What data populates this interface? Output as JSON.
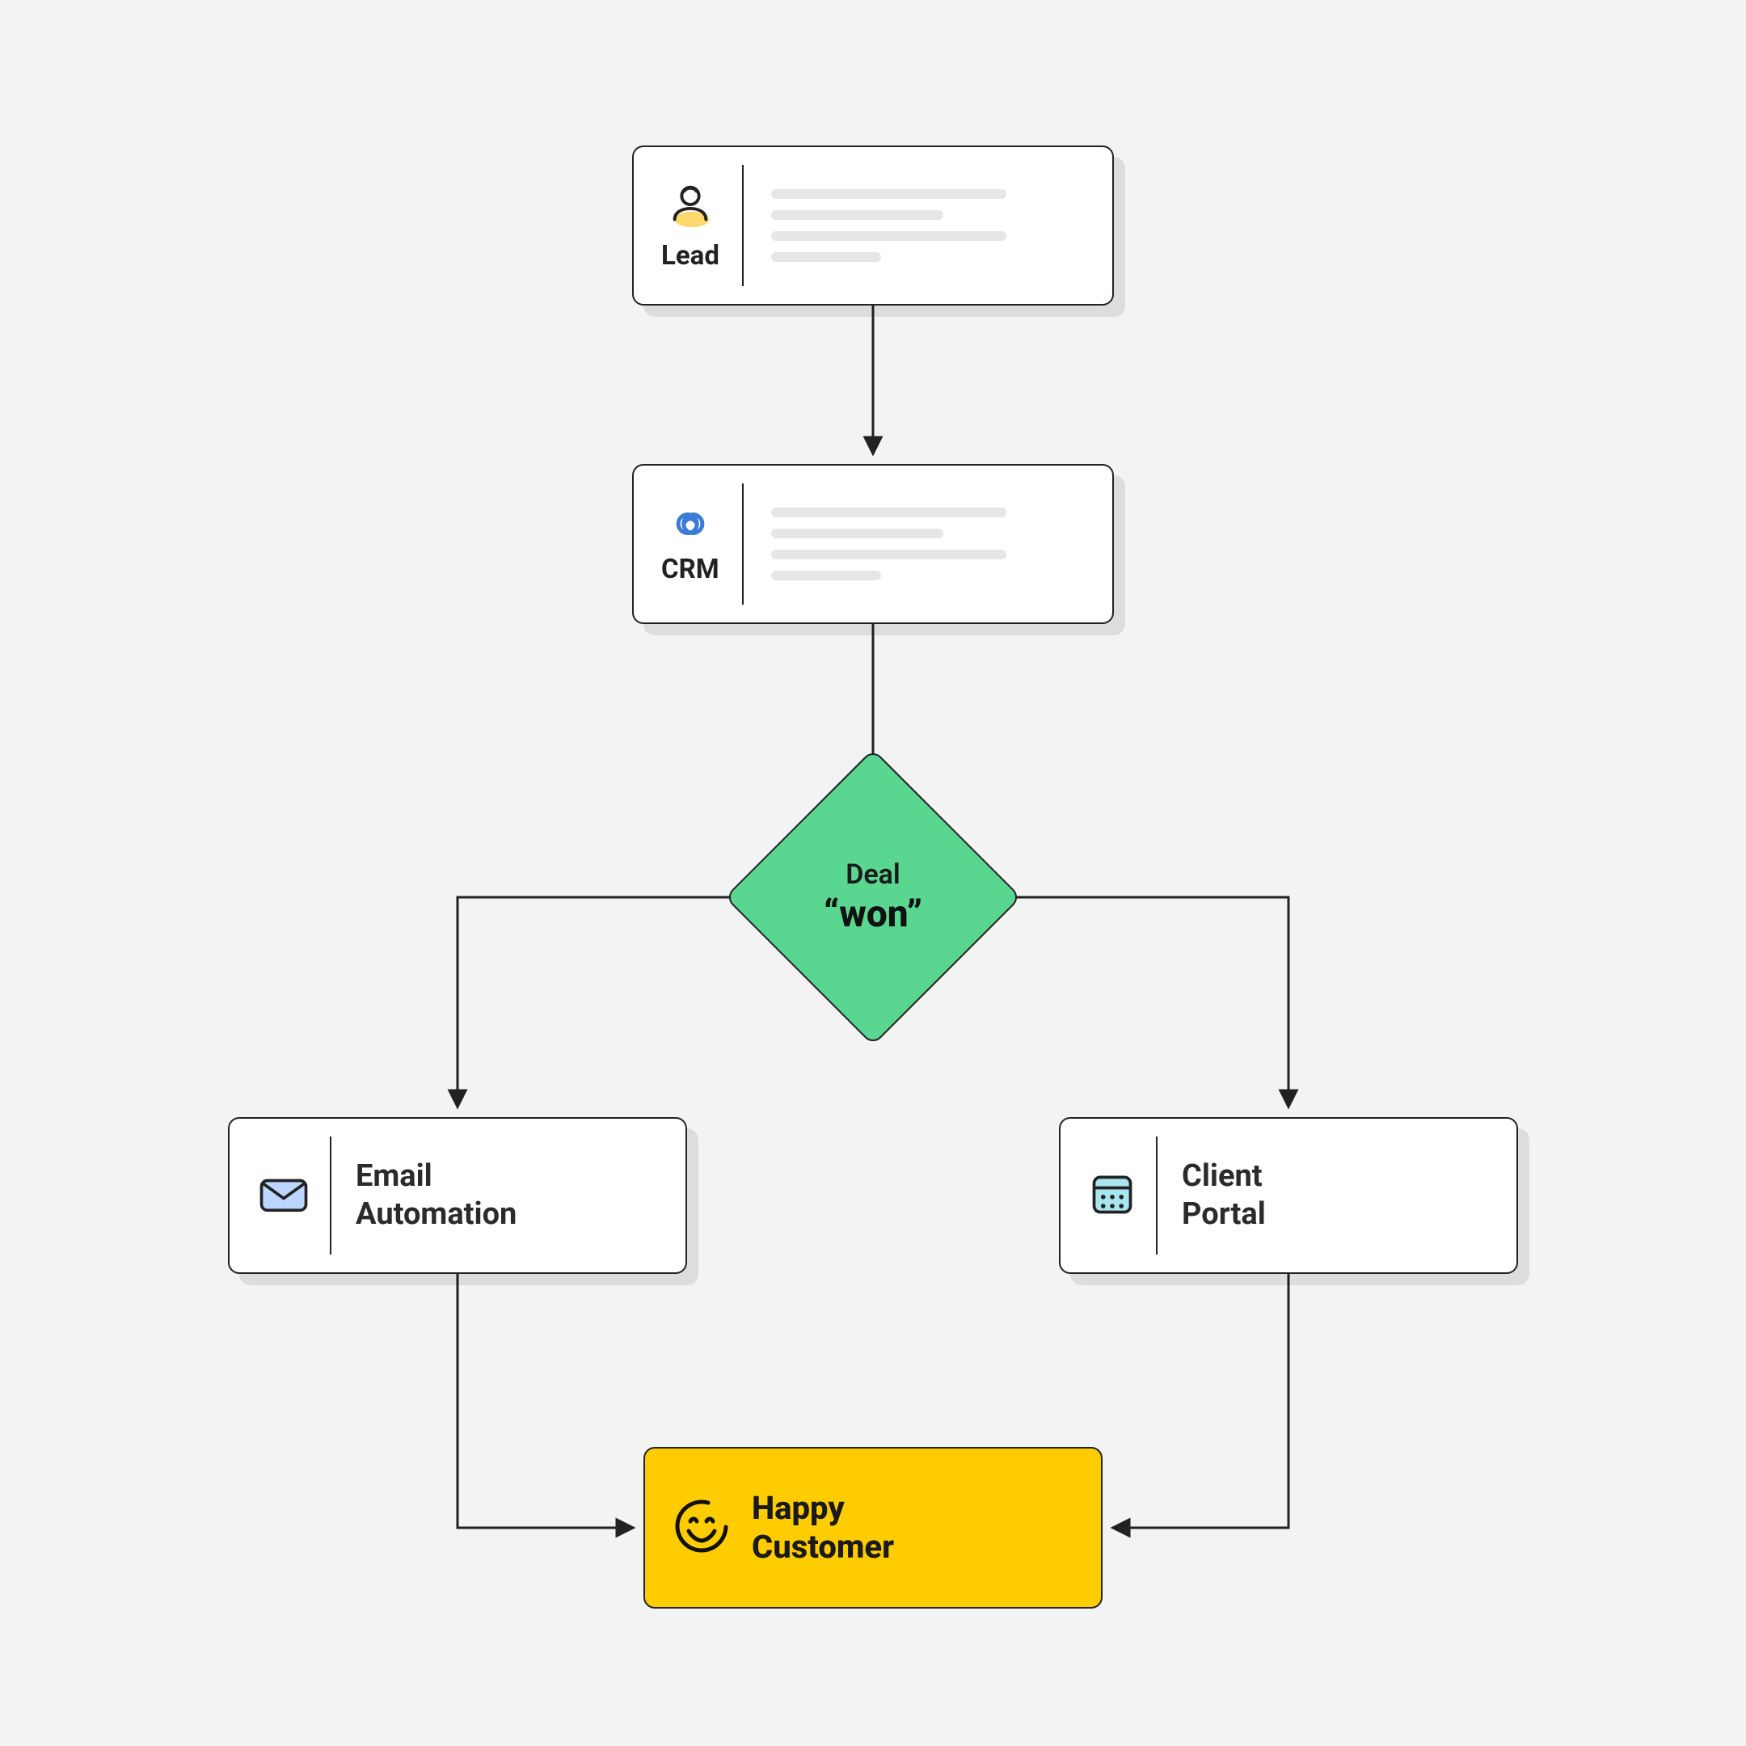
{
  "nodes": {
    "lead": {
      "label": "Lead"
    },
    "crm": {
      "label": "CRM"
    },
    "decision": {
      "label": "Deal",
      "value": "“won”"
    },
    "email": {
      "label": "Email\nAutomation"
    },
    "portal": {
      "label": "Client\nPortal"
    },
    "result": {
      "label": "Happy\nCustomer"
    }
  },
  "colors": {
    "bg": "#f3f3f3",
    "card": "#ffffff",
    "border": "#222222",
    "decision": "#59d68f",
    "result": "#ffcc00",
    "accentBlue": "#3a7bd5",
    "accentYellow": "#ffd86b"
  }
}
